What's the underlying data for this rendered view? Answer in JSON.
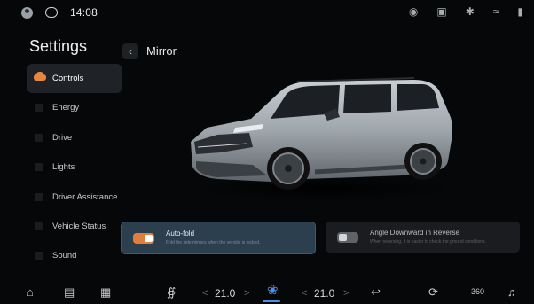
{
  "statusbar": {
    "time": "14:08",
    "icons": [
      "avatar-icon",
      "chat-icon",
      "camera-off-icon",
      "screen-off-icon",
      "bluetooth-icon",
      "wifi-icon",
      "signal-icon"
    ]
  },
  "sidebar": {
    "title": "Settings",
    "items": [
      {
        "label": "Controls",
        "active": true
      },
      {
        "label": "Energy",
        "active": false
      },
      {
        "label": "Drive",
        "active": false
      },
      {
        "label": "Lights",
        "active": false
      },
      {
        "label": "Driver Assistance",
        "active": false
      },
      {
        "label": "Vehicle Status",
        "active": false
      },
      {
        "label": "Sound",
        "active": false
      }
    ]
  },
  "header": {
    "back_icon": "chevron-left-icon",
    "title": "Mirror"
  },
  "options": [
    {
      "title": "Auto-fold",
      "description": "Fold the side mirrors when the vehicle is locked.",
      "enabled": true
    },
    {
      "title": "Angle Downward in Reverse",
      "description": "When reversing, it is easier to check the ground conditions.",
      "enabled": false
    }
  ],
  "dock": {
    "left_temp": "21.0",
    "right_temp": "21.0",
    "items": [
      "home-icon",
      "car-icon",
      "apps-grid-icon",
      "rear-defrost-icon",
      "fan-icon",
      "seat-heat-icon",
      "recirculation-icon",
      "camera-360-icon",
      "volume-icon"
    ],
    "camera_label": "360",
    "arrows": {
      "left": "<",
      "right": ">"
    }
  },
  "colors": {
    "accent": "#e07f3d",
    "fan": "#4f8ee8",
    "active_card": "#2c3f4f"
  }
}
